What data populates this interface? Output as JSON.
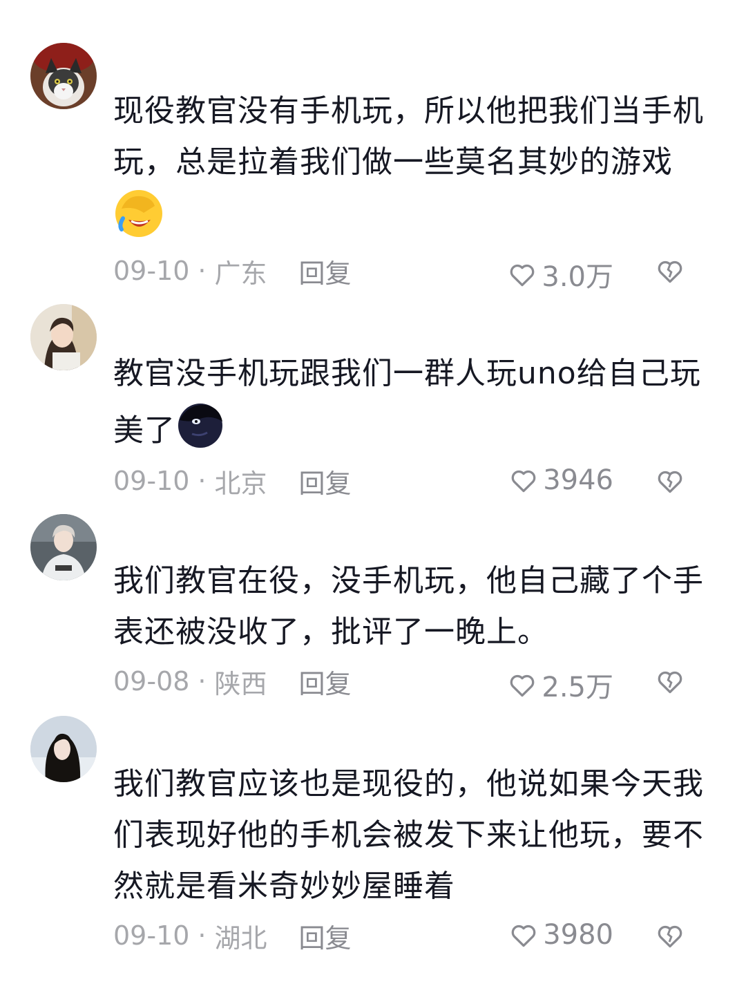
{
  "comments": [
    {
      "text": "现役教官没有手机玩，所以他把我们当手机玩，总是拉着我们做一些莫名其妙的游戏",
      "date": "09-10",
      "location": "广东",
      "reply_label": "回复",
      "likes": "3.0万",
      "emoji": "facepalm-laughing-emoji"
    },
    {
      "text": "教官没手机玩跟我们一群人玩uno给自己玩美了",
      "date": "09-10",
      "location": "北京",
      "reply_label": "回复",
      "likes": "3946",
      "emoji": "dark-face-emoji"
    },
    {
      "text": "我们教官在役，没手机玩，他自己藏了个手表还被没收了，批评了一晚上。",
      "date": "09-08",
      "location": "陕西",
      "reply_label": "回复",
      "likes": "2.5万"
    },
    {
      "text": "我们教官应该也是现役的，他说如果今天我们表现好他的手机会被发下来让他玩，要不然就是看米奇妙妙屋睡着",
      "date": "09-10",
      "location": "湖北",
      "reply_label": "回复",
      "likes": "3980"
    }
  ],
  "colors": {
    "text": "#161823",
    "meta": "#a6a7ab",
    "reply": "#8a8b91"
  }
}
